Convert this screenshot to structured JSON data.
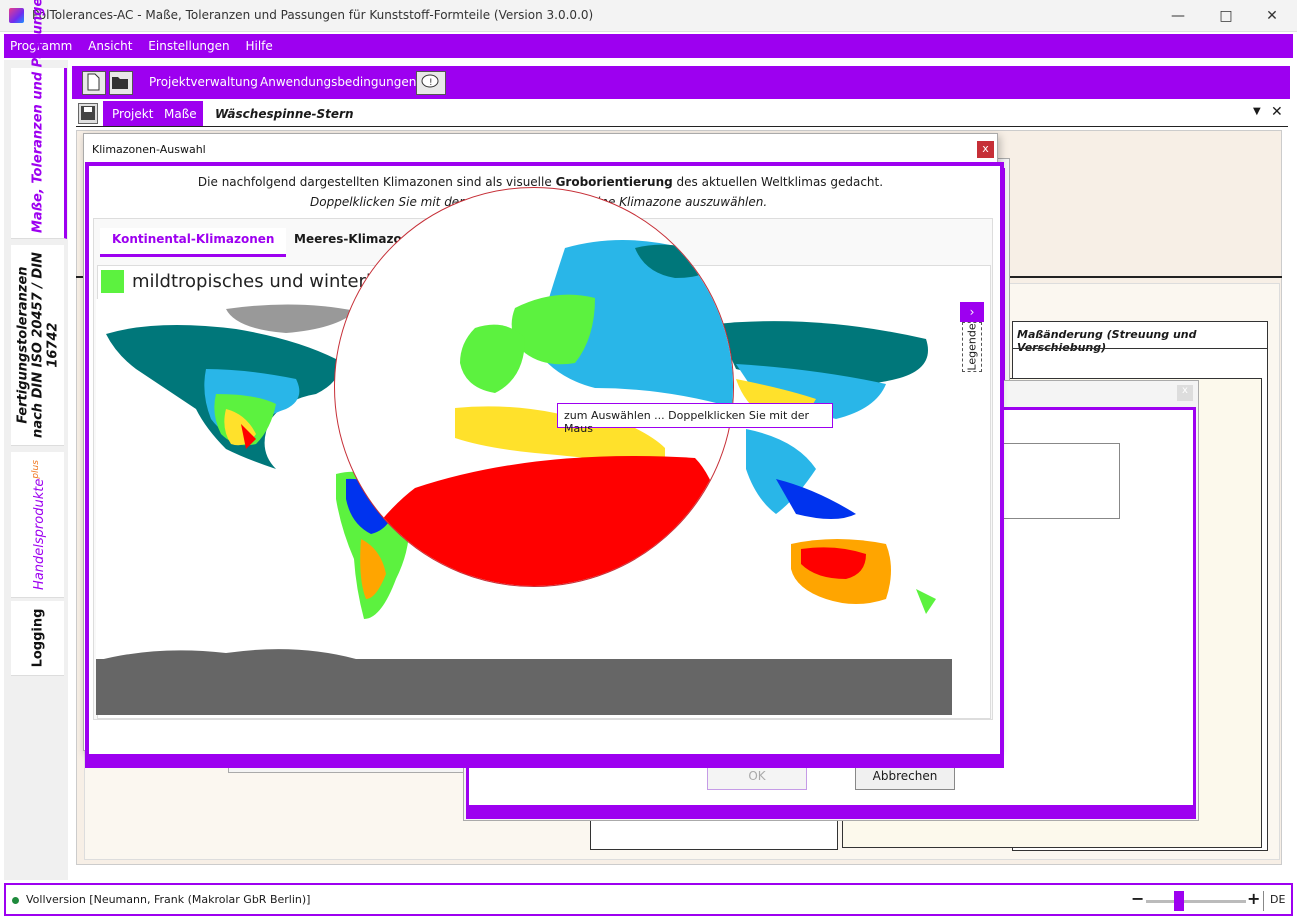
{
  "window": {
    "title": "PolTolerances-AC - Maße, Toleranzen und Passungen für Kunststoff-Formteile (Version 3.0.0.0)"
  },
  "menu": [
    "Programm",
    "Ansicht",
    "Einstellungen",
    "Hilfe"
  ],
  "sidetabs": [
    {
      "label": "Maße, Toleranzen und Passungen"
    },
    {
      "label": "Fertigungstoleranzen nach DIN ISO 20457 / DIN 16742"
    },
    {
      "label": "Handelsprodukte",
      "sup": "plus"
    },
    {
      "label": "Logging"
    }
  ],
  "toolbar": {
    "project_mgmt": "Projektverwaltung",
    "conditions": "Anwendungsbedingungen"
  },
  "projbar": {
    "tab_project": "Projekt",
    "tab_measures": "Maße",
    "project_name": "Wäschespinne-Stern"
  },
  "background": {
    "column_header": "Maßänderung (Streuung und Verschiebung)",
    "ok": "OK",
    "cancel": "Abbrechen"
  },
  "dialog": {
    "title": "Klimazonen-Auswahl",
    "close": "x",
    "intro_pre": "Die nachfolgend dargestellten Klimazonen sind als visuelle ",
    "intro_bold": "Groborientierung",
    "intro_post": " des aktuellen Weltklimas gedacht.",
    "hint": "Doppelklicken Sie mit der ",
    "hint_end": "ine Klimazone auszuwählen.",
    "tabs": [
      "Kontinental-Klimazonen",
      "Meeres-Klimazo"
    ],
    "zone_label": "mildtropisches und winterk",
    "legend": "Legende",
    "tooltip": "zum Auswählen ... Doppelklicken Sie mit der Maus"
  },
  "status": {
    "license": "Vollversion [Neumann, Frank (Makrolar GbR Berlin)]",
    "lang": "DE"
  },
  "colors": {
    "accent": "#9d00f0",
    "zone_green": "#5cf23f",
    "desert_red": "#ff0000",
    "ocean_land_gray": "#666666",
    "teal": "#00777a"
  }
}
